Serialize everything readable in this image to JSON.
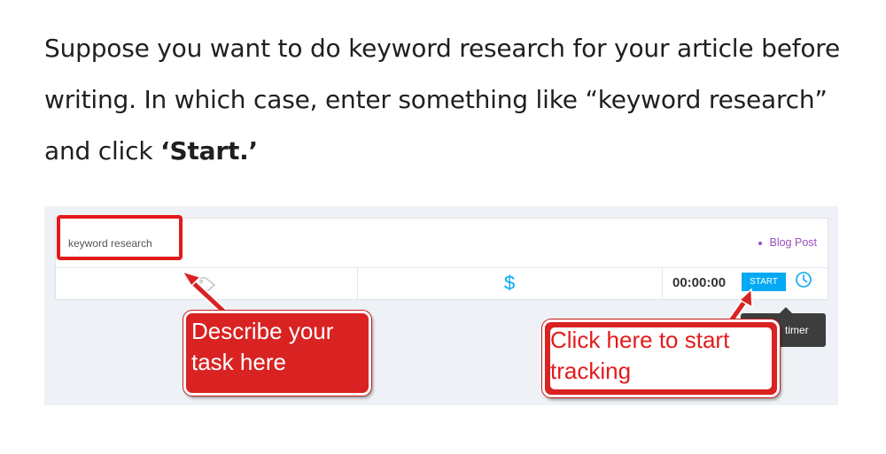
{
  "paragraph": {
    "text_before": "Suppose you want to do keyword research for your article before writing. In which case, enter something like “keyword research” and click ",
    "bold": "‘Start.’"
  },
  "tracker": {
    "task_value": "keyword research",
    "project_label": "Blog Post",
    "billable_symbol": "$",
    "timer_value": "00:00:00",
    "start_label": "START",
    "tooltip_text": "timer"
  },
  "annotations": {
    "callout_describe": "Describe your\ntask here",
    "callout_start": "Click here to start\ntracking"
  },
  "colors": {
    "accent_blue": "#03a9f4",
    "project_purple": "#9b4dbb",
    "annotation_red": "#e31b1b"
  },
  "icons": [
    "tag-icon",
    "dollar-icon",
    "clock-icon"
  ]
}
